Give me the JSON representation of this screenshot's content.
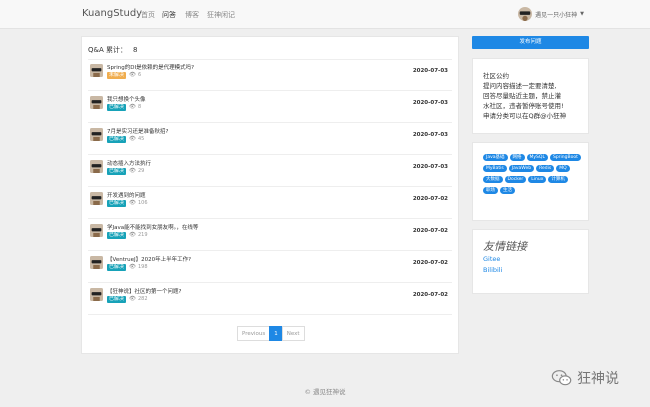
{
  "nav": {
    "brand": "KuangStudy",
    "links": [
      "首页",
      "问答",
      "博客",
      "狂神闲记"
    ],
    "user_name": "遇见一只小狂神",
    "caret": "▼"
  },
  "qa": {
    "header_label": "Q&A 累计：",
    "count": "8",
    "eye": "👁",
    "questions": [
      {
        "title": "Spring的DI是依赖的是代理模式吗?",
        "status": "未解决",
        "views": "6",
        "date": "2020-07-03"
      },
      {
        "title": "我只想换个头像",
        "status": "已解决",
        "views": "8",
        "date": "2020-07-03"
      },
      {
        "title": "7月是实习还是准备秋招?",
        "status": "已解决",
        "views": "45",
        "date": "2020-07-03"
      },
      {
        "title": "动态插入方法执行",
        "status": "已解决",
        "views": "29",
        "date": "2020-07-03"
      },
      {
        "title": "开发遇到的问题",
        "status": "已解决",
        "views": "106",
        "date": "2020-07-02"
      },
      {
        "title": "学Java能不能找到女朋友啊。，在线等",
        "status": "已解决",
        "views": "219",
        "date": "2020-07-02"
      },
      {
        "title": "【VentrueJ】2020年上半年工作?",
        "status": "已解决",
        "views": "198",
        "date": "2020-07-02"
      },
      {
        "title": "【狂神说】社区的第一个问题?",
        "status": "已解决",
        "views": "282",
        "date": "2020-07-02"
      }
    ]
  },
  "pager": {
    "prev": "Previous",
    "page": "1",
    "next": "Next"
  },
  "sidebar": {
    "post_button": "发布问题",
    "notice_head": "社区公约",
    "notice_lines": [
      "提问内容描述一定要清楚,",
      "回答尽量贴近主题，禁止灌",
      "水社区，违者暂停账号使用!",
      "申请分类可以在Q群@小狂神"
    ],
    "tags": [
      "Java基础",
      "网络",
      "MySQL",
      "SpringBoot",
      "MyBatis",
      "JavaWeb",
      "Redis",
      "MQ",
      "大数据",
      "Docker",
      "Linux",
      "计算机",
      "职场",
      "生活"
    ],
    "links_title": "友情链接",
    "links": [
      "Gitee",
      "Bilibili"
    ]
  },
  "footer": "© 遇见狂神说",
  "watermark": "狂神说",
  "colors": {
    "accent": "#1e88e5",
    "unsolved": "#f0ad4e",
    "solved": "#17a2b8"
  }
}
